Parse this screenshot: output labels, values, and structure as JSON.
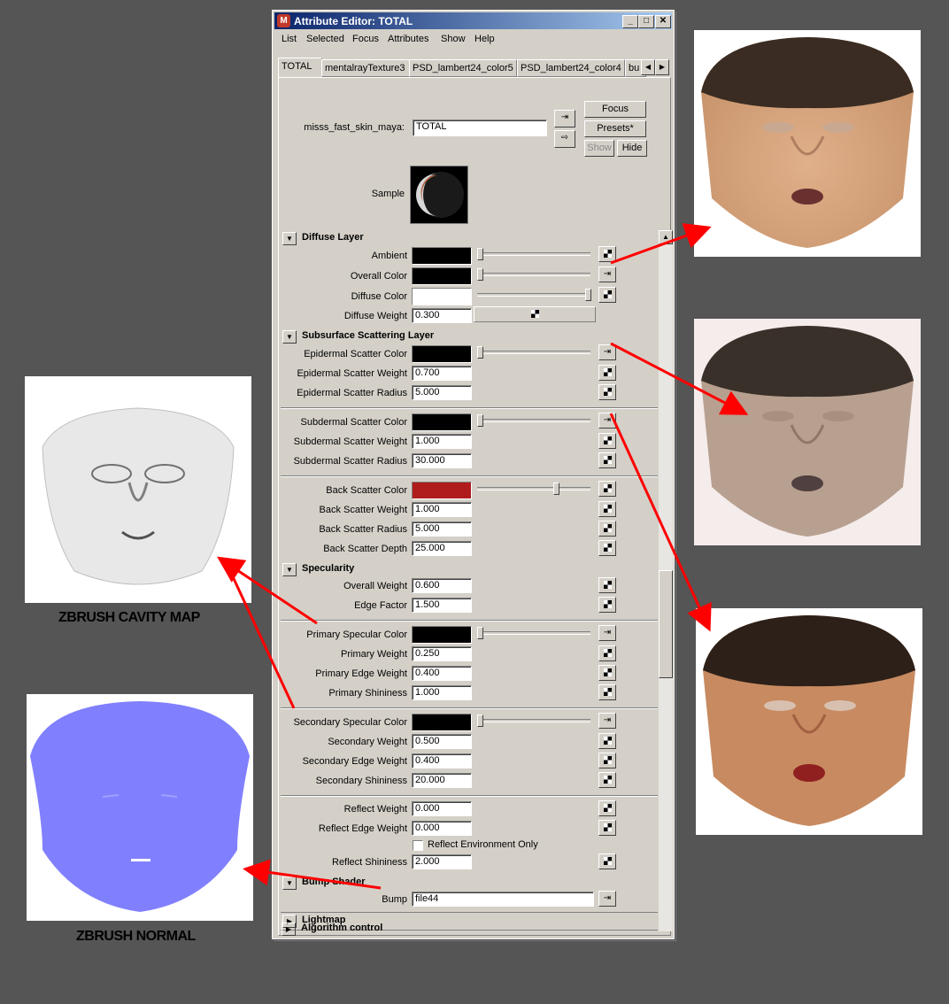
{
  "window": {
    "title": "Attribute Editor: TOTAL",
    "menu": [
      "List",
      "Selected",
      "Focus",
      "Attributes",
      "Show",
      "Help"
    ],
    "tabs": [
      "TOTAL",
      "mentalrayTexture3",
      "PSD_lambert24_color5",
      "PSD_lambert24_color4",
      "bu"
    ],
    "node_label": "misss_fast_skin_maya:",
    "node_name": "TOTAL",
    "buttons": {
      "focus": "Focus",
      "presets": "Presets*",
      "show": "Show",
      "hide": "Hide"
    },
    "sample_label": "Sample"
  },
  "sections": {
    "diffuse": {
      "title": "Diffuse Layer",
      "ambient": "Ambient",
      "overall_color": "Overall Color",
      "diffuse_color": "Diffuse Color",
      "diffuse_weight_label": "Diffuse Weight",
      "diffuse_weight": "0.300"
    },
    "sss": {
      "title": "Subsurface Scattering Layer",
      "epi_color": "Epidermal Scatter Color",
      "epi_weight_label": "Epidermal Scatter Weight",
      "epi_weight": "0.700",
      "epi_radius_label": "Epidermal Scatter Radius",
      "epi_radius": "5.000",
      "sub_color": "Subdermal Scatter Color",
      "sub_weight_label": "Subdermal Scatter Weight",
      "sub_weight": "1.000",
      "sub_radius_label": "Subdermal Scatter Radius",
      "sub_radius": "30.000",
      "back_color": "Back Scatter Color",
      "back_weight_label": "Back Scatter Weight",
      "back_weight": "1.000",
      "back_radius_label": "Back Scatter Radius",
      "back_radius": "5.000",
      "back_depth_label": "Back Scatter Depth",
      "back_depth": "25.000"
    },
    "spec": {
      "title": "Specularity",
      "overall_weight_label": "Overall Weight",
      "overall_weight": "0.600",
      "edge_factor_label": "Edge Factor",
      "edge_factor": "1.500",
      "primary_color": "Primary Specular Color",
      "primary_weight_label": "Primary Weight",
      "primary_weight": "0.250",
      "primary_edge_label": "Primary Edge Weight",
      "primary_edge": "0.400",
      "primary_shine_label": "Primary Shininess",
      "primary_shine": "1.000",
      "secondary_color": "Secondary Specular Color",
      "secondary_weight_label": "Secondary Weight",
      "secondary_weight": "0.500",
      "secondary_edge_label": "Secondary Edge Weight",
      "secondary_edge": "0.400",
      "secondary_shine_label": "Secondary Shininess",
      "secondary_shine": "20.000",
      "reflect_weight_label": "Reflect Weight",
      "reflect_weight": "0.000",
      "reflect_edge_label": "Reflect Edge Weight",
      "reflect_edge": "0.000",
      "reflect_env_label": "Reflect Environment Only",
      "reflect_shine_label": "Reflect Shininess",
      "reflect_shine": "2.000"
    },
    "bump": {
      "title": "Bump Shader",
      "bump_label": "Bump",
      "bump_value": "file44"
    },
    "lightmap": {
      "title": "Lightmap"
    },
    "algorithm": {
      "title": "Algorithm control"
    }
  },
  "captions": {
    "cavity": "ZBRUSH CAVITY MAP",
    "normal": "ZBRUSH NORMAL"
  },
  "colors": {
    "background": "#555555",
    "arrow": "#ff0000",
    "back_scatter": "#b01c1c",
    "normal_map": "#8080ff"
  }
}
